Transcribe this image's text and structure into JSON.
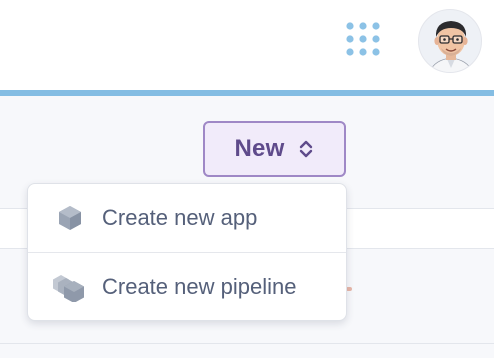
{
  "header": {
    "apps_icon": "grid-dots-icon",
    "avatar_icon": "cartoon-avatar-icon",
    "accent_color": "#84bde3"
  },
  "toolbar": {
    "new_button_label": "New",
    "new_button_icon": "chevron-up-down-icon",
    "accent_color": "#5f4b8b"
  },
  "dropdown": {
    "items": [
      {
        "label": "Create new app",
        "icon": "hexagon-icon"
      },
      {
        "label": "Create new pipeline",
        "icon": "stacked-hexagons-icon"
      }
    ]
  }
}
